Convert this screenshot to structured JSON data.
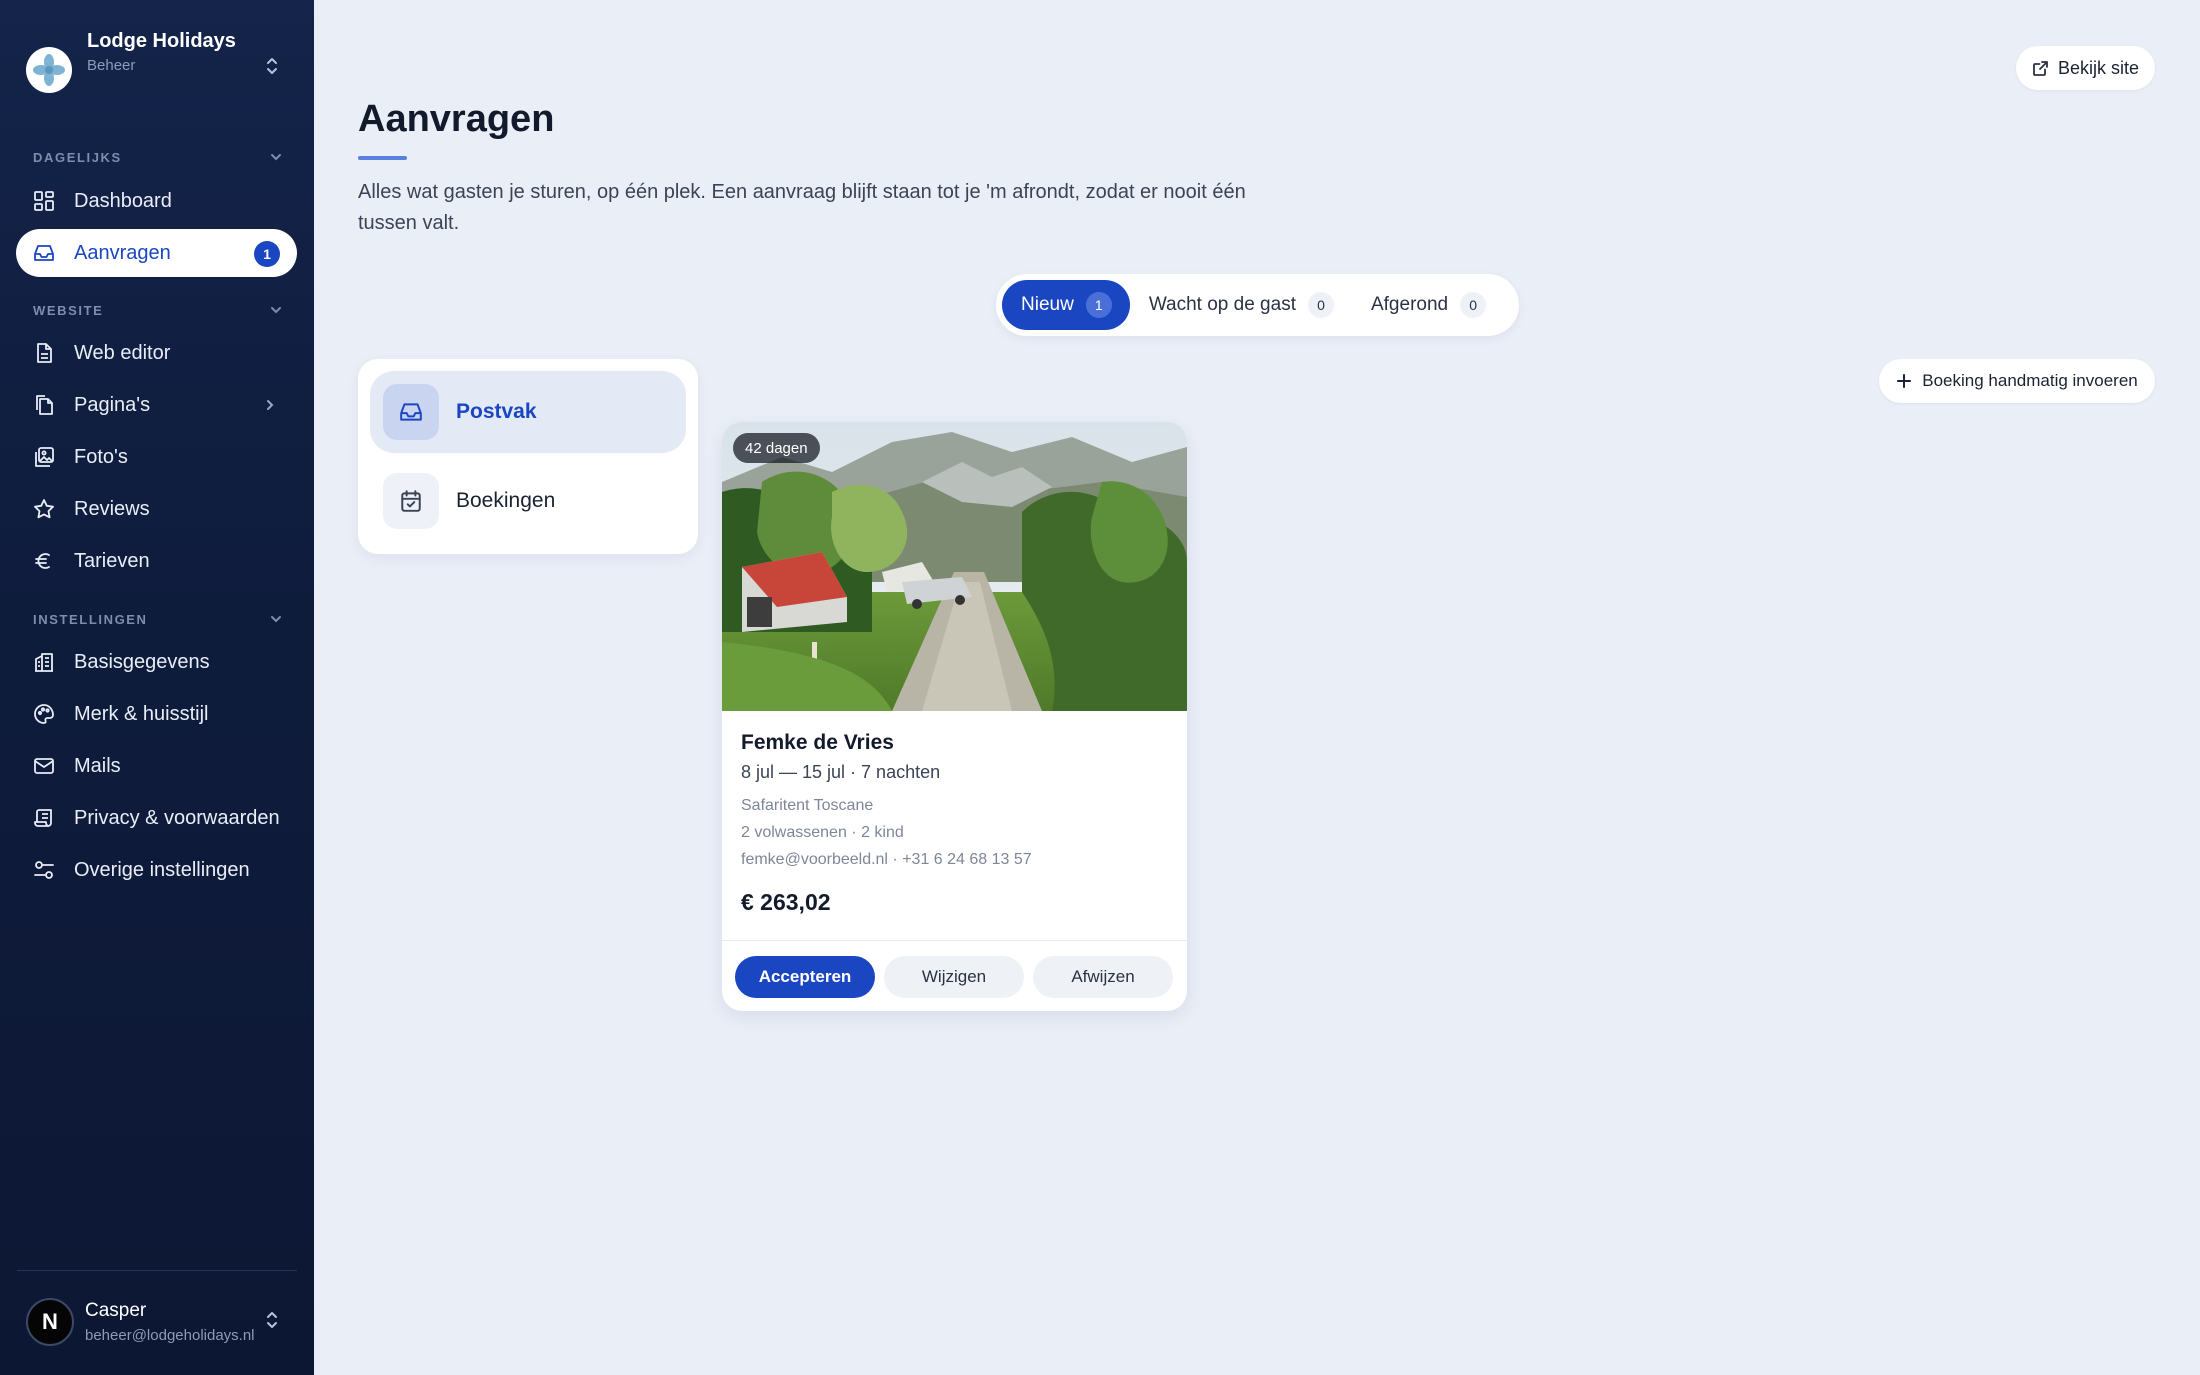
{
  "brand": {
    "name": "Lodge Holidays",
    "subtitle": "Beheer"
  },
  "sidebar": {
    "sections": [
      {
        "label": "DAGELIJKS"
      },
      {
        "label": "WEBSITE"
      },
      {
        "label": "INSTELLINGEN"
      }
    ],
    "items": [
      {
        "label": "Dashboard",
        "icon": "dashboard-icon"
      },
      {
        "label": "Aanvragen",
        "icon": "inbox-icon",
        "badge": "1",
        "active": true
      },
      {
        "label": "Web editor",
        "icon": "document-icon"
      },
      {
        "label": "Pagina's",
        "icon": "pages-icon"
      },
      {
        "label": "Foto's",
        "icon": "photos-icon"
      },
      {
        "label": "Reviews",
        "icon": "star-icon"
      },
      {
        "label": "Tarieven",
        "icon": "euro-icon"
      },
      {
        "label": "Basisgegevens",
        "icon": "building-icon"
      },
      {
        "label": "Merk & huisstijl",
        "icon": "palette-icon"
      },
      {
        "label": "Mails",
        "icon": "mail-icon"
      },
      {
        "label": "Privacy & voorwaarden",
        "icon": "scroll-icon"
      },
      {
        "label": "Overige instellingen",
        "icon": "sliders-icon"
      }
    ]
  },
  "user": {
    "name": "Casper",
    "email": "beheer@lodgeholidays.nl",
    "avatar_letter": "N"
  },
  "header": {
    "view_site_label": "Bekijk site"
  },
  "page": {
    "title": "Aanvragen",
    "description": "Alles wat gasten je sturen, op één plek. Een aanvraag blijft staan tot je 'm afrondt, zodat er nooit één tussen valt."
  },
  "tabs": [
    {
      "label": "Nieuw",
      "count": "1",
      "active": true
    },
    {
      "label": "Wacht op de gast",
      "count": "0"
    },
    {
      "label": "Afgerond",
      "count": "0"
    }
  ],
  "manual_entry_label": "Boeking handmatig invoeren",
  "folders": [
    {
      "label": "Postvak",
      "icon": "inbox-icon",
      "active": true
    },
    {
      "label": "Boekingen",
      "icon": "calendar-check-icon"
    }
  ],
  "request_card": {
    "age_badge": "42 dagen",
    "guest_name": "Femke de Vries",
    "dates": "8 jul — 15 jul · 7 nachten",
    "accommodation": "Safaritent Toscane",
    "guests": "2 volwassenen · 2 kind",
    "contact": "femke@voorbeeld.nl · +31 6 24 68 13 57",
    "price": "€ 263,02",
    "actions": {
      "accept": "Accepteren",
      "modify": "Wijzigen",
      "reject": "Afwijzen"
    }
  },
  "colors": {
    "primary": "#1b46c2",
    "sidebar_bg": "#0f1d3e",
    "page_bg": "#eaeef7"
  }
}
